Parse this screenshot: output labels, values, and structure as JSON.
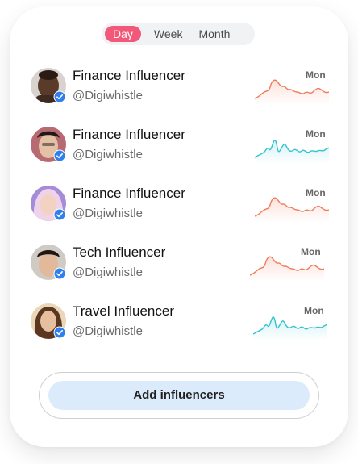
{
  "periods": {
    "day": "Day",
    "week": "Week",
    "month": "Month",
    "active": "Day"
  },
  "influencers": [
    {
      "name": "Finance Influencer",
      "handle": "@Digiwhistle",
      "day": "Mon",
      "trend_color": "#f07a5a",
      "avatar_icon": "person-avatar"
    },
    {
      "name": "Finance Influencer",
      "handle": "@Digiwhistle",
      "day": "Mon",
      "trend_color": "#34c3cf",
      "avatar_icon": "person-avatar"
    },
    {
      "name": "Finance Influencer",
      "handle": "@Digiwhistle",
      "day": "Mon",
      "trend_color": "#f07a5a",
      "avatar_icon": "person-avatar"
    },
    {
      "name": "Tech Influencer",
      "handle": "@Digiwhistle",
      "day": "Mon",
      "trend_color": "#f07a5a",
      "avatar_icon": "person-avatar"
    },
    {
      "name": "Travel Influencer",
      "handle": "@Digiwhistle",
      "day": "Mon",
      "trend_color": "#34c3cf",
      "avatar_icon": "person-avatar"
    }
  ],
  "verified_badge_color": "#2f80ed",
  "add_button_label": "Add influencers",
  "accent_color": "#f2587a"
}
